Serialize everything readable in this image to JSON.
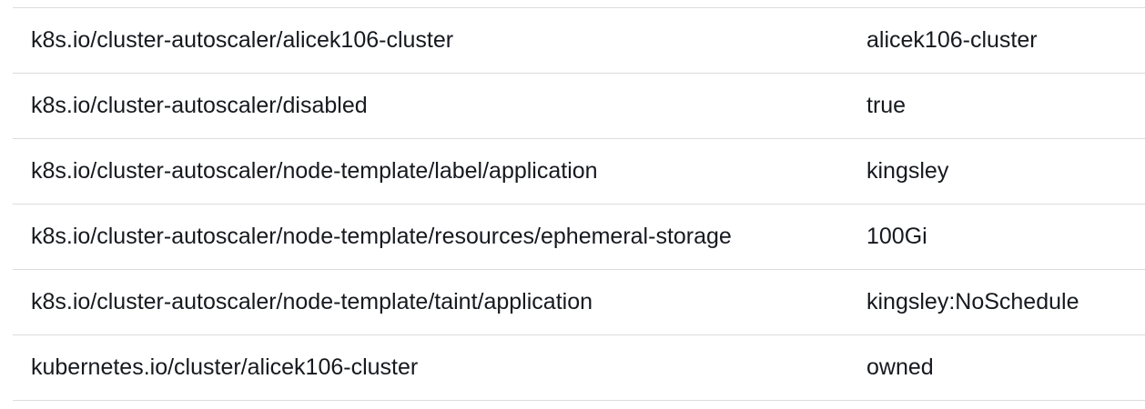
{
  "tags": {
    "rows": [
      {
        "key": "k8s.io/cluster-autoscaler/alicek106-cluster",
        "value": "alicek106-cluster"
      },
      {
        "key": "k8s.io/cluster-autoscaler/disabled",
        "value": "true"
      },
      {
        "key": "k8s.io/cluster-autoscaler/node-template/label/application",
        "value": "kingsley"
      },
      {
        "key": "k8s.io/cluster-autoscaler/node-template/resources/ephemeral-storage",
        "value": "100Gi"
      },
      {
        "key": "k8s.io/cluster-autoscaler/node-template/taint/application",
        "value": "kingsley:NoSchedule"
      },
      {
        "key": "kubernetes.io/cluster/alicek106-cluster",
        "value": "owned"
      }
    ]
  }
}
